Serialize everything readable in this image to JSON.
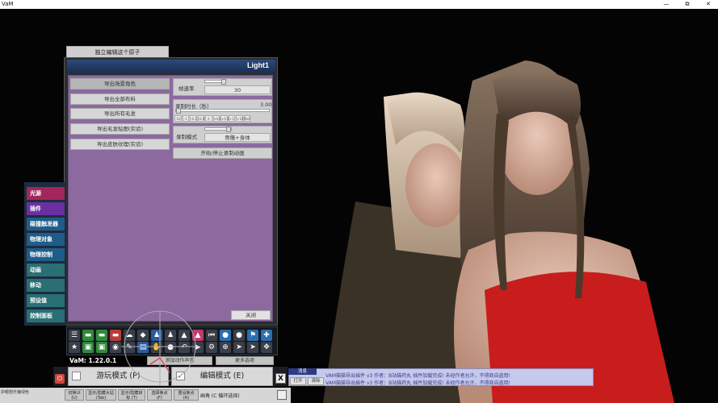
{
  "window": {
    "title": "VaM",
    "controls": {
      "minimize": "—",
      "maximize": "⧉",
      "close": "✕"
    }
  },
  "top_tab": {
    "label": "独立编辑这个原子"
  },
  "panel": {
    "atom_name": "Light1",
    "buttons": [
      "导出场景角色",
      "导出全部布料",
      "导出所有毛发",
      "导出毛发贴图(实验)",
      "导出皮肤纹理(实验)"
    ],
    "frame_rate": {
      "label": "帧速率",
      "value": "30"
    },
    "record_duration": {
      "label": "录制时长（秒）",
      "value": "3.00"
    },
    "tick_buttons": [
      "-10",
      "-1",
      "-0.1",
      "-0.01",
      "0",
      "+0.01",
      "+0.1",
      "+1",
      "+10",
      "ReC"
    ],
    "record_mode": {
      "label": "录制模式",
      "value": "骨骼+身体"
    },
    "toggle_record": "开始/停止录制动画",
    "close": "关闭"
  },
  "nav": {
    "items": [
      {
        "label": "光源",
        "color": "#a2265b"
      },
      {
        "label": "插件",
        "color": "#6a2fa0"
      },
      {
        "label": "碰撞触发器",
        "color": "#1f5d88"
      },
      {
        "label": "物理对象",
        "color": "#1f5d88"
      },
      {
        "label": "物理控制",
        "color": "#1f5d88"
      },
      {
        "label": "动画",
        "color": "#2a6f74"
      },
      {
        "label": "移动",
        "color": "#2a6f74"
      },
      {
        "label": "预设值",
        "color": "#2a6f74"
      },
      {
        "label": "控制面板",
        "color": "#2a6f74"
      }
    ]
  },
  "toolbar": {
    "icons_row1": [
      {
        "name": "menu-icon",
        "glyph": "☰",
        "color": "#3a3f4a"
      },
      {
        "name": "folder-icon",
        "glyph": "▬",
        "color": "#2f8a3c"
      },
      {
        "name": "folder-open-icon",
        "glyph": "▬",
        "color": "#2f8a3c"
      },
      {
        "name": "save-icon",
        "glyph": "▬",
        "color": "#b93c3c"
      },
      {
        "name": "cloud-icon",
        "glyph": "☁",
        "color": "#3a3f4a"
      },
      {
        "name": "package-icon",
        "glyph": "◆",
        "color": "#3a3f4a"
      },
      {
        "name": "person-icon",
        "glyph": "♟",
        "color": "#2a5aa0"
      },
      {
        "name": "person-edit-icon",
        "glyph": "♟",
        "color": "#3a3f4a"
      },
      {
        "name": "warning-icon",
        "glyph": "▲",
        "color": "#3a3f4a"
      },
      {
        "name": "layers-icon",
        "glyph": "▲",
        "color": "#c23a6a"
      },
      {
        "name": "skip-back-icon",
        "glyph": "⏮",
        "color": "#3a3f4a"
      },
      {
        "name": "user-icon",
        "glyph": "●",
        "color": "#2a6fb0"
      },
      {
        "name": "group-icon",
        "glyph": "●",
        "color": "#3a3f4a"
      },
      {
        "name": "flag-icon",
        "glyph": "⚑",
        "color": "#2a6fb0"
      },
      {
        "name": "plus-icon",
        "glyph": "✚",
        "color": "#2a6fb0"
      }
    ],
    "icons_row2": [
      {
        "name": "star-icon",
        "glyph": "★",
        "color": "#3a3f4a"
      },
      {
        "name": "image-icon",
        "glyph": "▣",
        "color": "#2f8a3c"
      },
      {
        "name": "image-alt-icon",
        "glyph": "▣",
        "color": "#2f8a3c"
      },
      {
        "name": "camera-icon",
        "glyph": "◉",
        "color": "#3a3f4a"
      },
      {
        "name": "script-icon",
        "glyph": "✎",
        "color": "#3a3f4a"
      },
      {
        "name": "book-icon",
        "glyph": "▤",
        "color": "#2a5aa0"
      },
      {
        "name": "hand-icon",
        "glyph": "✋",
        "color": "#3a3f4a"
      },
      {
        "name": "record-icon",
        "glyph": "●",
        "color": "#3a3f4a"
      },
      {
        "name": "undo-icon",
        "glyph": "↶",
        "color": "#3a3f4a"
      },
      {
        "name": "play-icon",
        "glyph": "▶",
        "color": "#3a3f4a"
      },
      {
        "name": "settings-icon",
        "glyph": "⚙",
        "color": "#3a3f4a"
      },
      {
        "name": "target-icon",
        "glyph": "⊕",
        "color": "#3a3f4a"
      },
      {
        "name": "pointer-icon",
        "glyph": "➤",
        "color": "#3a3f4a"
      },
      {
        "name": "cursor-icon",
        "glyph": "➤",
        "color": "#3a3f4a"
      },
      {
        "name": "move-icon",
        "glyph": "✥",
        "color": "#3a3f4a"
      }
    ]
  },
  "version": "VaM: 1.22.0.1",
  "add_action_button": "添加动作声音",
  "more_options_button": "更多选项",
  "modes": {
    "play": "游玩模式 (P)",
    "edit": "编辑模式 (E)",
    "close": "X"
  },
  "message": {
    "header": "消息",
    "open": "打开",
    "clear": "清除",
    "lines": [
      "VAM猫猫导出插件 v3 作者：B站猫药丸 插件加载完成! 未经作者允许，不得商自盗用!",
      "VAM猫猫导出插件 v3 作者：B站猫药丸 插件加载完成! 未经作者允许，不得商自盗用!"
    ]
  },
  "bottom_bar": {
    "left_text": "护眼想乐偏绿色",
    "buttons": [
      {
        "line1": "切换UI",
        "line2": "(U)"
      },
      {
        "line1": "显示/隐藏大站",
        "line2": "(Tab)"
      },
      {
        "line1": "显示/隐藏目",
        "line2": "标 (T)"
      },
      {
        "line1": "选择焦点",
        "line2": "(F)"
      },
      {
        "line1": "重设焦点",
        "line2": "(R)"
      }
    ],
    "camera_label": "画角 (C 循环选择)"
  }
}
